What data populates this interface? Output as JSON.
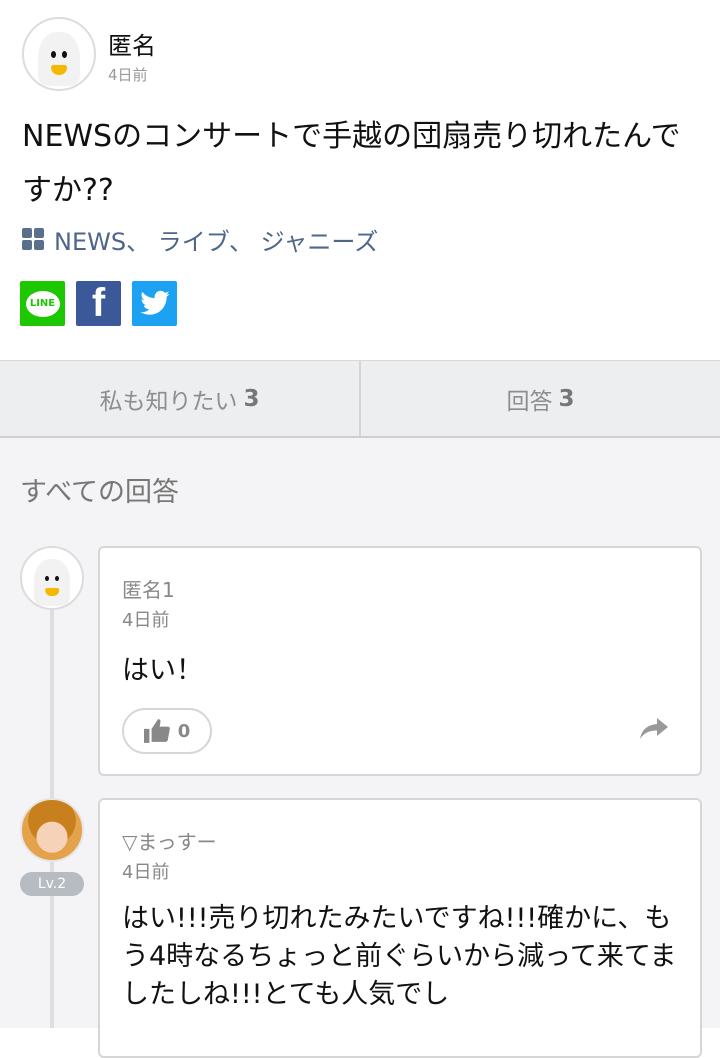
{
  "question": {
    "author": "匿名",
    "date": "4日前",
    "title": "NEWSのコンサートで手越の団扇売り切れたんですか??",
    "categories_text": "NEWS、 ライブ、 ジャニーズ",
    "share": {
      "line_label": "LINE",
      "facebook_label": "f"
    }
  },
  "tabs": [
    {
      "label": "私も知りたい",
      "count": "3"
    },
    {
      "label": "回答",
      "count": "3"
    }
  ],
  "answers_section": {
    "heading": "すべての回答",
    "items": [
      {
        "author": "匿名1",
        "date": "4日前",
        "body": "はい！",
        "likes": "0"
      },
      {
        "author": "▽まっすー",
        "date": "4日前",
        "level": "Lv.2",
        "body": "はい!!!売り切れたみたいですね!!!確かに、もう4時なるちょっと前ぐらいから減って来てましたしね!!!とても人気でし"
      }
    ]
  },
  "colors": {
    "line": "#1ec800",
    "facebook": "#3b5998",
    "twitter": "#1da1f2",
    "category": "#4d6689"
  },
  "icons": [
    "ghost-avatar-icon",
    "grid-icon",
    "line-icon",
    "facebook-icon",
    "twitter-icon",
    "thumbs-up-icon",
    "share-arrow-icon"
  ]
}
